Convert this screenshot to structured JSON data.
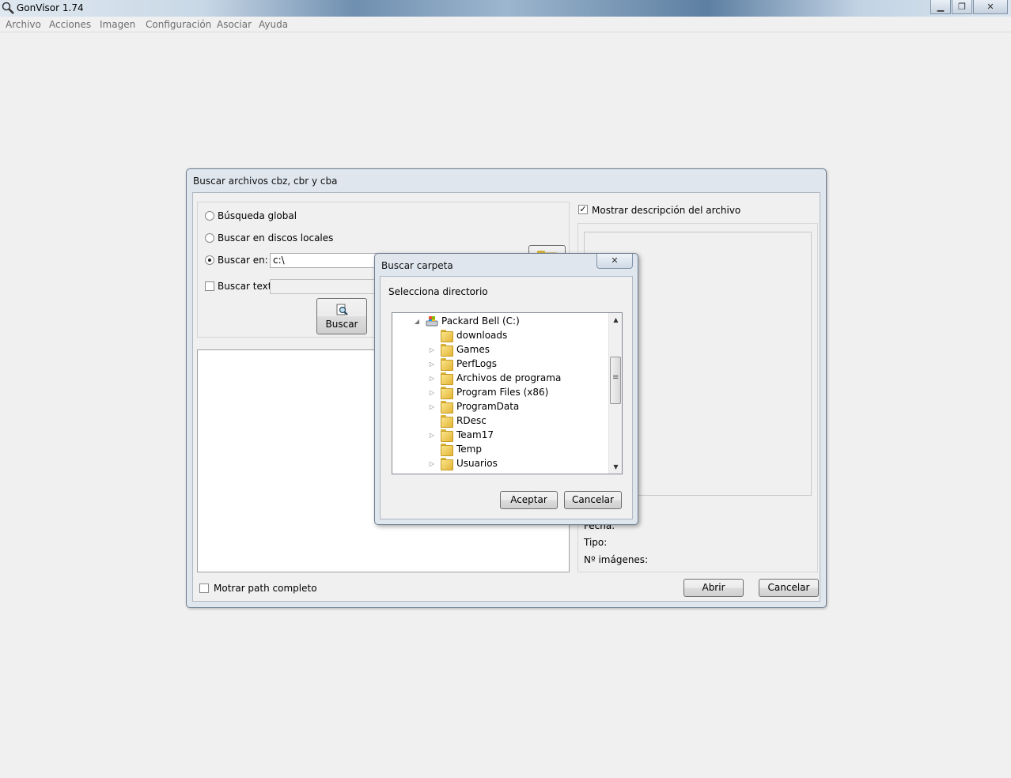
{
  "app": {
    "title": "GonVisor 1.74",
    "window_buttons": [
      "minimize",
      "restore",
      "close"
    ]
  },
  "menubar": {
    "items": [
      "Archivo",
      "Acciones",
      "Imagen",
      "Configuración",
      "Asociar",
      "Ayuda"
    ]
  },
  "search_dialog": {
    "title": "Buscar archivos cbz, cbr y cba",
    "radio_global": "Búsqueda global",
    "radio_local": "Buscar en discos locales",
    "radio_in": "Buscar en:",
    "search_in_value": "c:\\",
    "check_text": "Buscar texto:",
    "search_button": "Buscar",
    "show_description": "Mostrar descripción del archivo",
    "show_description_checked": true,
    "info_fecha": "Fecha:",
    "info_tipo": "Tipo:",
    "info_images": "Nº imágenes:",
    "full_path": "Motrar path completo",
    "open_button": "Abrir",
    "cancel_button": "Cancelar"
  },
  "folder_dialog": {
    "title": "Buscar carpeta",
    "prompt": "Selecciona directorio",
    "root": "Packard Bell (C:)",
    "folders": [
      {
        "name": "downloads",
        "expandable": false
      },
      {
        "name": "Games",
        "expandable": true
      },
      {
        "name": "PerfLogs",
        "expandable": true
      },
      {
        "name": "Archivos de programa",
        "expandable": true
      },
      {
        "name": "Program Files (x86)",
        "expandable": true
      },
      {
        "name": "ProgramData",
        "expandable": true
      },
      {
        "name": "RDesc",
        "expandable": false
      },
      {
        "name": "Team17",
        "expandable": true
      },
      {
        "name": "Temp",
        "expandable": false
      },
      {
        "name": "Usuarios",
        "expandable": true
      }
    ],
    "ok_button": "Aceptar",
    "cancel_button": "Cancelar"
  }
}
